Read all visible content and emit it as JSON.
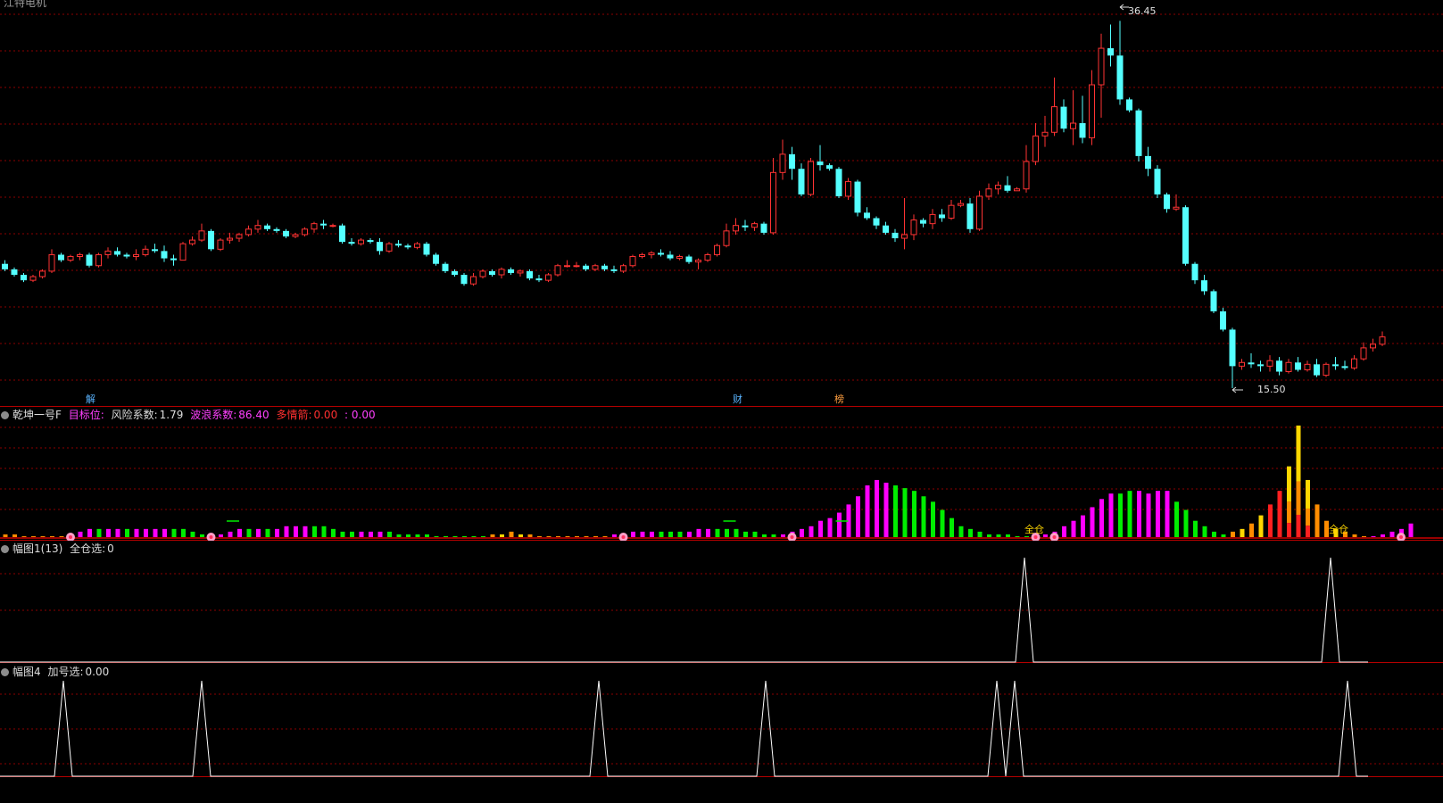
{
  "window": {
    "title_partial": "江特电机"
  },
  "colors": {
    "up": "#ff3333",
    "down": "#54ffff",
    "grid": "#8b0000",
    "divider": "#b40000",
    "magenta": "#ff00ff",
    "green": "#00ee00",
    "yellow": "#ffd700",
    "orange": "#ff8c00",
    "white": "#ffffff",
    "cyan_text": "#6ab4ff"
  },
  "price_panel": {
    "high_label": "36.45",
    "low_label": "15.50",
    "markers": [
      {
        "text": "解",
        "color": "#5ab4ff"
      },
      {
        "text": "财",
        "color": "#5ab4ff"
      },
      {
        "text": "榜",
        "color": "#ff9f40"
      }
    ]
  },
  "indicator1": {
    "name": "乾坤一号F",
    "target_label": "目标位:",
    "risk_label": "风险系数:",
    "risk_value": "1.79",
    "wave_label": "波浪系数:",
    "wave_value": "86.40",
    "bull_label": "多情箭:",
    "bull_value": "0.00",
    "extra_value": ": 0.00",
    "signal_labels": [
      "全仓",
      "全仓"
    ]
  },
  "indicator2": {
    "name": "幅图1(13)",
    "label": "全仓选:",
    "value": "0"
  },
  "indicator3": {
    "name": "幅图4",
    "label": "加号选:",
    "value": "0.00"
  },
  "chart_data": {
    "type": "candlestick",
    "price_range": [
      15.5,
      36.45
    ],
    "candles": [
      [
        22.4,
        22.6,
        22.0,
        22.1
      ],
      [
        22.1,
        22.2,
        21.7,
        21.8
      ],
      [
        21.8,
        21.9,
        21.4,
        21.5
      ],
      [
        21.5,
        21.8,
        21.4,
        21.7
      ],
      [
        21.7,
        22.1,
        21.6,
        22.0
      ],
      [
        22.0,
        23.2,
        21.9,
        22.9
      ],
      [
        22.9,
        23.0,
        22.5,
        22.6
      ],
      [
        22.6,
        22.9,
        22.5,
        22.8
      ],
      [
        22.8,
        23.0,
        22.6,
        22.9
      ],
      [
        22.9,
        23.0,
        22.2,
        22.3
      ],
      [
        22.3,
        23.0,
        22.2,
        22.9
      ],
      [
        22.9,
        23.3,
        22.7,
        23.1
      ],
      [
        23.1,
        23.3,
        22.8,
        22.9
      ],
      [
        22.9,
        23.0,
        22.7,
        22.8
      ],
      [
        22.8,
        23.2,
        22.6,
        22.9
      ],
      [
        22.9,
        23.4,
        22.8,
        23.2
      ],
      [
        23.2,
        23.5,
        23.0,
        23.1
      ],
      [
        23.1,
        23.4,
        22.5,
        22.7
      ],
      [
        22.7,
        22.9,
        22.3,
        22.6
      ],
      [
        22.6,
        23.6,
        22.6,
        23.5
      ],
      [
        23.5,
        23.9,
        23.4,
        23.7
      ],
      [
        23.7,
        24.6,
        23.6,
        24.2
      ],
      [
        24.2,
        24.3,
        23.1,
        23.2
      ],
      [
        23.2,
        23.8,
        23.1,
        23.7
      ],
      [
        23.7,
        24.1,
        23.5,
        23.8
      ],
      [
        23.8,
        24.1,
        23.6,
        24.0
      ],
      [
        24.0,
        24.5,
        23.9,
        24.3
      ],
      [
        24.3,
        24.8,
        24.1,
        24.5
      ],
      [
        24.5,
        24.6,
        24.2,
        24.3
      ],
      [
        24.3,
        24.4,
        24.1,
        24.2
      ],
      [
        24.2,
        24.3,
        23.8,
        23.9
      ],
      [
        23.9,
        24.1,
        23.8,
        24.0
      ],
      [
        24.0,
        24.4,
        23.9,
        24.3
      ],
      [
        24.3,
        24.7,
        24.1,
        24.6
      ],
      [
        24.6,
        24.8,
        24.3,
        24.5
      ],
      [
        24.5,
        24.6,
        24.4,
        24.5
      ],
      [
        24.5,
        24.6,
        23.5,
        23.6
      ],
      [
        23.6,
        23.8,
        23.4,
        23.5
      ],
      [
        23.5,
        23.8,
        23.4,
        23.7
      ],
      [
        23.7,
        23.8,
        23.5,
        23.6
      ],
      [
        23.6,
        23.8,
        22.9,
        23.1
      ],
      [
        23.1,
        23.6,
        23.0,
        23.5
      ],
      [
        23.5,
        23.7,
        23.3,
        23.4
      ],
      [
        23.4,
        23.5,
        23.2,
        23.3
      ],
      [
        23.3,
        23.6,
        23.2,
        23.5
      ],
      [
        23.5,
        23.6,
        22.8,
        22.9
      ],
      [
        22.9,
        23.0,
        22.3,
        22.4
      ],
      [
        22.4,
        22.5,
        21.9,
        22.0
      ],
      [
        22.0,
        22.1,
        21.7,
        21.8
      ],
      [
        21.8,
        21.9,
        21.2,
        21.3
      ],
      [
        21.3,
        21.9,
        21.2,
        21.7
      ],
      [
        21.7,
        22.1,
        21.6,
        22.0
      ],
      [
        22.0,
        22.1,
        21.7,
        21.8
      ],
      [
        21.8,
        22.2,
        21.6,
        22.1
      ],
      [
        22.1,
        22.2,
        21.8,
        21.9
      ],
      [
        21.9,
        22.1,
        21.7,
        22.0
      ],
      [
        22.0,
        22.1,
        21.5,
        21.6
      ],
      [
        21.6,
        21.8,
        21.4,
        21.5
      ],
      [
        21.5,
        21.9,
        21.4,
        21.8
      ],
      [
        21.8,
        22.4,
        21.7,
        22.3
      ],
      [
        22.3,
        22.6,
        22.2,
        22.3
      ],
      [
        22.3,
        22.5,
        22.2,
        22.3
      ],
      [
        22.3,
        22.4,
        22.0,
        22.1
      ],
      [
        22.1,
        22.4,
        22.0,
        22.3
      ],
      [
        22.3,
        22.4,
        22.0,
        22.1
      ],
      [
        22.1,
        22.3,
        21.9,
        22.0
      ],
      [
        22.0,
        22.4,
        21.9,
        22.3
      ],
      [
        22.3,
        22.9,
        22.2,
        22.8
      ],
      [
        22.8,
        23.0,
        22.7,
        22.9
      ],
      [
        22.9,
        23.1,
        22.7,
        23.0
      ],
      [
        23.0,
        23.2,
        22.8,
        22.9
      ],
      [
        22.9,
        23.1,
        22.6,
        22.7
      ],
      [
        22.7,
        22.9,
        22.6,
        22.8
      ],
      [
        22.8,
        22.9,
        22.4,
        22.5
      ],
      [
        22.5,
        22.7,
        22.1,
        22.6
      ],
      [
        22.6,
        23.0,
        22.5,
        22.9
      ],
      [
        22.9,
        23.5,
        22.8,
        23.4
      ],
      [
        23.4,
        24.6,
        23.3,
        24.2
      ],
      [
        24.2,
        24.9,
        24.0,
        24.5
      ],
      [
        24.5,
        24.8,
        24.2,
        24.4
      ],
      [
        24.4,
        24.7,
        24.2,
        24.6
      ],
      [
        24.6,
        24.7,
        24.0,
        24.1
      ],
      [
        24.1,
        28.2,
        24.0,
        27.4
      ],
      [
        27.4,
        29.2,
        27.0,
        28.4
      ],
      [
        28.4,
        28.8,
        27.0,
        27.6
      ],
      [
        27.6,
        27.9,
        26.1,
        26.2
      ],
      [
        26.2,
        28.2,
        26.1,
        28.0
      ],
      [
        28.0,
        28.9,
        27.5,
        27.8
      ],
      [
        27.8,
        27.9,
        27.5,
        27.6
      ],
      [
        27.6,
        27.7,
        26.0,
        26.1
      ],
      [
        26.1,
        27.1,
        25.9,
        26.9
      ],
      [
        26.9,
        27.0,
        25.0,
        25.2
      ],
      [
        25.2,
        25.5,
        24.8,
        24.9
      ],
      [
        24.9,
        25.0,
        24.3,
        24.5
      ],
      [
        24.5,
        24.7,
        24.0,
        24.1
      ],
      [
        24.1,
        24.3,
        23.6,
        23.8
      ],
      [
        23.8,
        26.0,
        23.2,
        24.0
      ],
      [
        24.0,
        25.1,
        23.7,
        24.8
      ],
      [
        24.8,
        24.9,
        24.4,
        24.6
      ],
      [
        24.6,
        25.4,
        24.3,
        25.1
      ],
      [
        25.1,
        25.4,
        24.7,
        24.9
      ],
      [
        24.9,
        25.9,
        24.8,
        25.6
      ],
      [
        25.6,
        25.9,
        25.5,
        25.7
      ],
      [
        25.7,
        26.0,
        24.1,
        24.3
      ],
      [
        24.3,
        26.4,
        24.2,
        26.1
      ],
      [
        26.1,
        26.8,
        25.9,
        26.5
      ],
      [
        26.5,
        26.9,
        26.2,
        26.7
      ],
      [
        26.7,
        27.2,
        26.3,
        26.4
      ],
      [
        26.4,
        26.6,
        26.4,
        26.5
      ],
      [
        26.5,
        28.9,
        26.3,
        28.0
      ],
      [
        28.0,
        30.1,
        27.8,
        29.4
      ],
      [
        29.4,
        30.5,
        28.8,
        29.6
      ],
      [
        29.6,
        32.6,
        29.4,
        31.0
      ],
      [
        31.0,
        31.4,
        29.6,
        29.8
      ],
      [
        29.8,
        31.9,
        28.9,
        30.1
      ],
      [
        30.1,
        31.6,
        29.0,
        29.3
      ],
      [
        29.3,
        33.0,
        28.9,
        32.2
      ],
      [
        32.2,
        35.0,
        30.4,
        34.2
      ],
      [
        34.2,
        35.5,
        33.2,
        33.8
      ],
      [
        33.8,
        35.7,
        31.1,
        31.4
      ],
      [
        31.4,
        31.5,
        30.7,
        30.8
      ],
      [
        30.8,
        30.9,
        28.0,
        28.3
      ],
      [
        28.3,
        28.8,
        27.2,
        27.6
      ],
      [
        27.6,
        27.8,
        26.0,
        26.2
      ],
      [
        26.2,
        26.3,
        25.2,
        25.4
      ],
      [
        25.4,
        26.2,
        25.3,
        25.5
      ],
      [
        25.5,
        25.6,
        22.3,
        22.4
      ],
      [
        22.4,
        22.5,
        21.3,
        21.5
      ],
      [
        21.5,
        21.8,
        20.7,
        20.9
      ],
      [
        20.9,
        21.0,
        19.7,
        19.8
      ],
      [
        19.8,
        20.0,
        18.7,
        18.8
      ],
      [
        18.8,
        18.9,
        15.6,
        16.8
      ],
      [
        16.8,
        17.2,
        16.6,
        17.0
      ],
      [
        17.0,
        17.5,
        16.7,
        16.9
      ],
      [
        16.9,
        17.1,
        16.5,
        16.8
      ],
      [
        16.8,
        17.4,
        16.5,
        17.1
      ],
      [
        17.1,
        17.3,
        16.3,
        16.5
      ],
      [
        16.5,
        17.2,
        16.4,
        17.0
      ],
      [
        17.0,
        17.3,
        16.5,
        16.6
      ],
      [
        16.6,
        17.1,
        16.5,
        16.9
      ],
      [
        16.9,
        17.2,
        16.2,
        16.3
      ],
      [
        16.3,
        17.0,
        16.2,
        16.9
      ],
      [
        16.9,
        17.3,
        16.6,
        16.8
      ],
      [
        16.8,
        17.1,
        16.6,
        16.7
      ],
      [
        16.7,
        17.4,
        16.6,
        17.2
      ],
      [
        17.2,
        18.1,
        17.1,
        17.8
      ],
      [
        17.8,
        18.3,
        17.6,
        18.0
      ],
      [
        18.0,
        18.7,
        17.9,
        18.4
      ]
    ],
    "indicator1_bars": [
      [
        "o",
        1
      ],
      [
        "o",
        1
      ],
      [
        "o",
        0
      ],
      [
        "o",
        0
      ],
      [
        "o",
        0
      ],
      [
        "o",
        0
      ],
      [
        "o",
        0
      ],
      [
        "m",
        1
      ],
      [
        "m",
        2
      ],
      [
        "m",
        3
      ],
      [
        "g",
        3
      ],
      [
        "m",
        3
      ],
      [
        "m",
        3
      ],
      [
        "g",
        3
      ],
      [
        "m",
        3
      ],
      [
        "m",
        3
      ],
      [
        "m",
        3
      ],
      [
        "m",
        3
      ],
      [
        "g",
        3
      ],
      [
        "g",
        3
      ],
      [
        "g",
        2
      ],
      [
        "g",
        1
      ],
      [
        "m",
        1
      ],
      [
        "m",
        1
      ],
      [
        "m",
        2
      ],
      [
        "m",
        3
      ],
      [
        "g",
        3
      ],
      [
        "m",
        3
      ],
      [
        "g",
        3
      ],
      [
        "m",
        3
      ],
      [
        "m",
        4
      ],
      [
        "m",
        4
      ],
      [
        "m",
        4
      ],
      [
        "g",
        4
      ],
      [
        "g",
        4
      ],
      [
        "g",
        3
      ],
      [
        "g",
        2
      ],
      [
        "g",
        2
      ],
      [
        "m",
        2
      ],
      [
        "m",
        2
      ],
      [
        "m",
        2
      ],
      [
        "g",
        2
      ],
      [
        "g",
        1
      ],
      [
        "g",
        1
      ],
      [
        "g",
        1
      ],
      [
        "g",
        1
      ],
      [
        "g",
        0
      ],
      [
        "g",
        0
      ],
      [
        "g",
        0
      ],
      [
        "g",
        0
      ],
      [
        "g",
        0
      ],
      [
        "g",
        0
      ],
      [
        "o",
        1
      ],
      [
        "y",
        1
      ],
      [
        "o",
        2
      ],
      [
        "y",
        1
      ],
      [
        "o",
        1
      ],
      [
        "o",
        0
      ],
      [
        "o",
        0
      ],
      [
        "o",
        0
      ],
      [
        "o",
        0
      ],
      [
        "o",
        0
      ],
      [
        "o",
        0
      ],
      [
        "o",
        0
      ],
      [
        "o",
        0
      ],
      [
        "m",
        1
      ],
      [
        "m",
        1
      ],
      [
        "m",
        2
      ],
      [
        "m",
        2
      ],
      [
        "m",
        2
      ],
      [
        "g",
        2
      ],
      [
        "g",
        2
      ],
      [
        "g",
        2
      ],
      [
        "m",
        2
      ],
      [
        "m",
        3
      ],
      [
        "m",
        3
      ],
      [
        "g",
        3
      ],
      [
        "g",
        3
      ],
      [
        "g",
        3
      ],
      [
        "g",
        2
      ],
      [
        "g",
        2
      ],
      [
        "g",
        1
      ],
      [
        "g",
        1
      ],
      [
        "m",
        1
      ],
      [
        "m",
        2
      ],
      [
        "m",
        3
      ],
      [
        "m",
        4
      ],
      [
        "m",
        6
      ],
      [
        "m",
        7
      ],
      [
        "m",
        9
      ],
      [
        "m",
        12
      ],
      [
        "m",
        15
      ],
      [
        "m",
        19
      ],
      [
        "m",
        21
      ],
      [
        "m",
        20
      ],
      [
        "g",
        19
      ],
      [
        "g",
        18
      ],
      [
        "g",
        17
      ],
      [
        "g",
        15
      ],
      [
        "g",
        13
      ],
      [
        "g",
        10
      ],
      [
        "g",
        7
      ],
      [
        "g",
        4
      ],
      [
        "g",
        3
      ],
      [
        "g",
        2
      ],
      [
        "g",
        1
      ],
      [
        "g",
        1
      ],
      [
        "g",
        1
      ],
      [
        "g",
        0
      ],
      [
        "g",
        0
      ],
      [
        "g",
        0
      ],
      [
        "m",
        1
      ],
      [
        "m",
        2
      ],
      [
        "m",
        4
      ],
      [
        "m",
        6
      ],
      [
        "m",
        8
      ],
      [
        "m",
        11
      ],
      [
        "m",
        14
      ],
      [
        "m",
        16
      ],
      [
        "g",
        16
      ],
      [
        "g",
        17
      ],
      [
        "m",
        17
      ],
      [
        "m",
        16
      ],
      [
        "m",
        17
      ],
      [
        "m",
        17
      ],
      [
        "g",
        13
      ],
      [
        "g",
        10
      ],
      [
        "g",
        6
      ],
      [
        "g",
        4
      ],
      [
        "g",
        2
      ],
      [
        "g",
        1
      ],
      [
        "o",
        2
      ],
      [
        "y",
        3
      ],
      [
        "o",
        5
      ],
      [
        "y",
        8
      ],
      [
        "r",
        12
      ],
      [
        "r",
        17
      ],
      [
        "y",
        26
      ],
      [
        "y",
        41
      ],
      [
        "y",
        21
      ],
      [
        "o",
        12
      ],
      [
        "o",
        6
      ],
      [
        "y",
        3
      ],
      [
        "o",
        2
      ],
      [
        "o",
        1
      ],
      [
        "o",
        0
      ],
      [
        "m",
        0
      ],
      [
        "m",
        1
      ],
      [
        "m",
        2
      ],
      [
        "m",
        3
      ],
      [
        "m",
        5
      ]
    ]
  }
}
